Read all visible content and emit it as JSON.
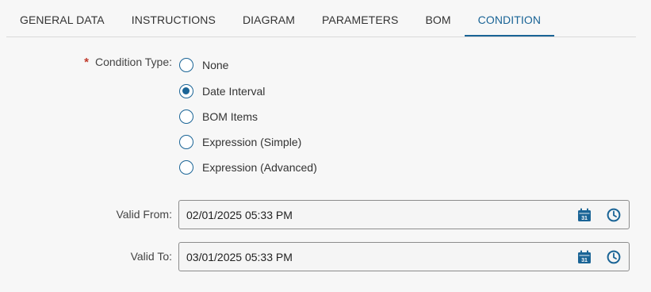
{
  "tabs": [
    {
      "label": "GENERAL DATA",
      "active": false
    },
    {
      "label": "INSTRUCTIONS",
      "active": false
    },
    {
      "label": "DIAGRAM",
      "active": false
    },
    {
      "label": "PARAMETERS",
      "active": false
    },
    {
      "label": "BOM",
      "active": false
    },
    {
      "label": "CONDITION",
      "active": true
    }
  ],
  "condition": {
    "required_mark": "*",
    "label": "Condition Type:",
    "options": [
      {
        "label": "None",
        "checked": false
      },
      {
        "label": "Date Interval",
        "checked": true
      },
      {
        "label": "BOM Items",
        "checked": false
      },
      {
        "label": "Expression (Simple)",
        "checked": false
      },
      {
        "label": "Expression (Advanced)",
        "checked": false
      }
    ]
  },
  "valid_from": {
    "label": "Valid From:",
    "value": "02/01/2025 05:33 PM"
  },
  "valid_to": {
    "label": "Valid To:",
    "value": "03/01/2025 05:33 PM"
  },
  "calendar_day": "31",
  "colors": {
    "accent": "#1a6496",
    "required": "#c0392b"
  },
  "icons": [
    "calendar-icon",
    "clock-icon"
  ]
}
